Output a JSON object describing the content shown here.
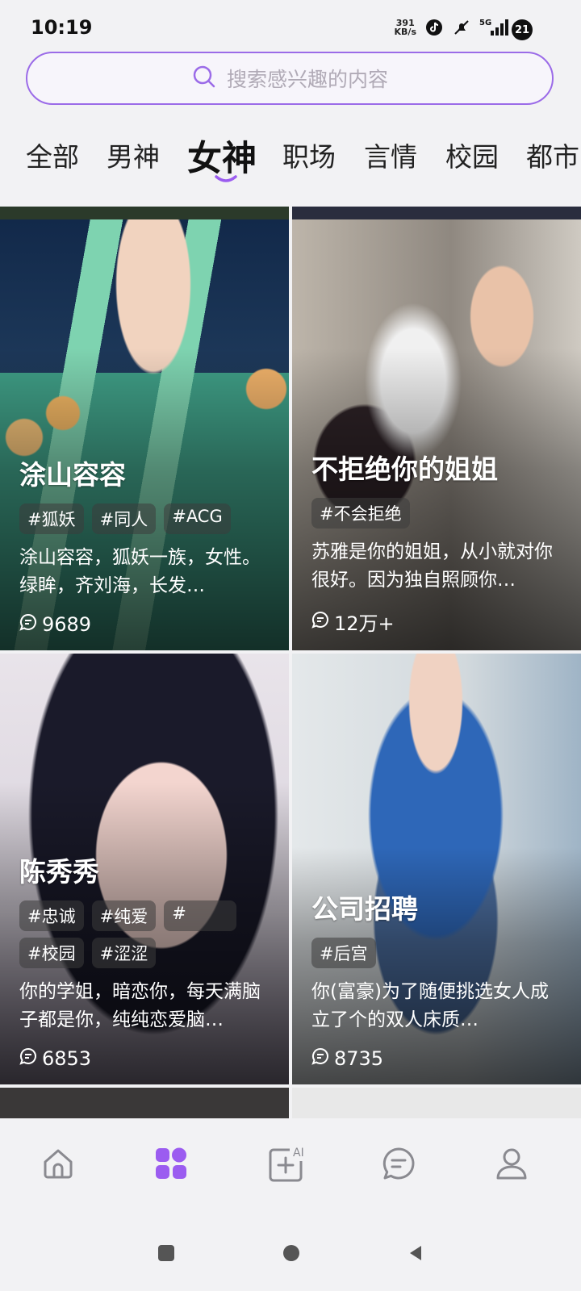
{
  "status_bar": {
    "time": "10:19",
    "net_speed_value": "391",
    "net_speed_unit": "KB/s",
    "network": "5G",
    "battery": "21"
  },
  "search": {
    "placeholder": "搜索感兴趣的内容",
    "icon": "search-icon"
  },
  "tabs": [
    {
      "label": "全部"
    },
    {
      "label": "男神"
    },
    {
      "label": "女神",
      "active": true
    },
    {
      "label": "职场"
    },
    {
      "label": "言情"
    },
    {
      "label": "校园"
    },
    {
      "label": "都市"
    }
  ],
  "cards": [
    {
      "title": "涂山容容",
      "tags": [
        "#狐妖",
        "#同人",
        "#ACG"
      ],
      "desc": "涂山容容，狐妖一族，女性。绿眸，齐刘海，长发…",
      "count": "9689"
    },
    {
      "title": "不拒绝你的姐姐",
      "tags": [
        "#不会拒绝"
      ],
      "desc": "苏雅是你的姐姐，从小就对你很好。因为独自照顾你…",
      "count": "12万+"
    },
    {
      "title": "陈秀秀",
      "tags": [
        "#忠诚",
        "#纯爱",
        "#",
        "#校园",
        "#涩涩"
      ],
      "desc": "你的学姐，暗恋你，每天满脑子都是你，纯纯恋爱脑…",
      "count": "6853"
    },
    {
      "title": "公司招聘",
      "tags": [
        "#后宫"
      ],
      "desc": "你(富豪)为了随便挑选女人成立了个的双人床质…",
      "count": "8735"
    }
  ],
  "colors": {
    "accent": "#9b6be8",
    "active_nav": "#9b5cf0",
    "icon_gray": "#8a8a90"
  },
  "bottom_nav": {
    "items": [
      "home-icon",
      "discover-icon",
      "ai-create-icon",
      "messages-icon",
      "profile-icon"
    ],
    "ai_badge": "AI"
  }
}
